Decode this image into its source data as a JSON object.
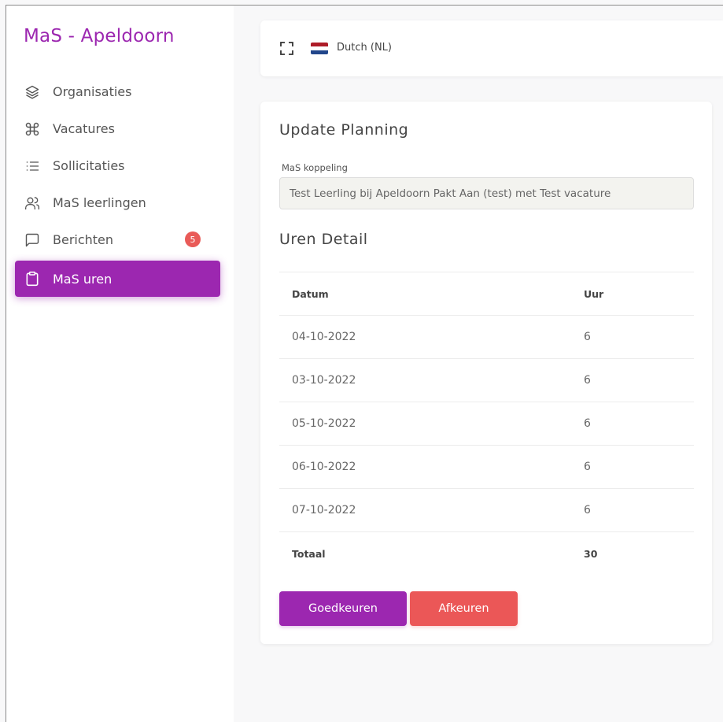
{
  "brand": {
    "title": "MaS - Apeldoorn",
    "color": "#9c27b0"
  },
  "sidebar": {
    "items": [
      {
        "label": "Organisaties",
        "icon": "layers-icon",
        "active": false
      },
      {
        "label": "Vacatures",
        "icon": "command-icon",
        "active": false
      },
      {
        "label": "Sollicitaties",
        "icon": "list-icon",
        "active": false
      },
      {
        "label": "MaS leerlingen",
        "icon": "users-icon",
        "active": false
      },
      {
        "label": "Berichten",
        "icon": "message-square-icon",
        "active": false,
        "badge": "5"
      },
      {
        "label": "MaS uren",
        "icon": "clipboard-icon",
        "active": true
      }
    ]
  },
  "topbar": {
    "language": "Dutch (NL)",
    "flag_icon": "flag-nl-icon",
    "expand_icon": "fullscreen-icon"
  },
  "card": {
    "title": "Update Planning",
    "koppeling_label": "MaS koppeling",
    "koppeling_value": "Test Leerling bij Apeldoorn Pakt Aan (test) met Test vacature",
    "detail_title": "Uren Detail",
    "table": {
      "headers": [
        "Datum",
        "Uur"
      ],
      "rows": [
        [
          "04-10-2022",
          "6"
        ],
        [
          "03-10-2022",
          "6"
        ],
        [
          "05-10-2022",
          "6"
        ],
        [
          "06-10-2022",
          "6"
        ],
        [
          "07-10-2022",
          "6"
        ]
      ],
      "total_label": "Totaal",
      "total_value": "30"
    },
    "approve_label": "Goedkeuren",
    "reject_label": "Afkeuren"
  },
  "colors": {
    "accent": "#9c27b0",
    "danger": "#eb5757",
    "badge": "#e95b58"
  }
}
